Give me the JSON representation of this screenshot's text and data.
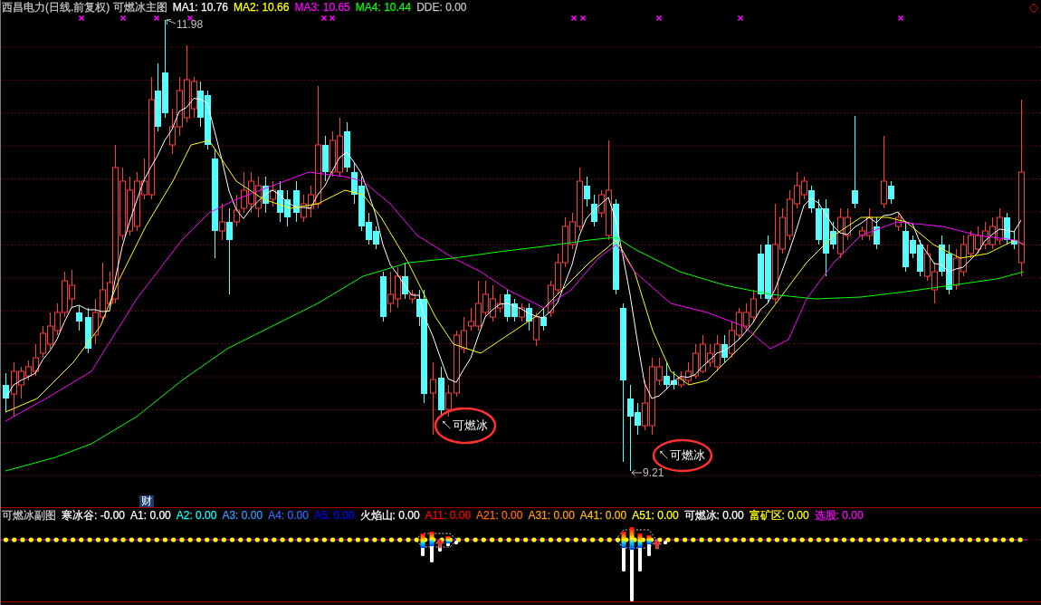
{
  "main_chart": {
    "title": "西昌电力(日线.前复权) 可燃冰主图",
    "indicators": [
      {
        "text": "MA1: 10.76",
        "color": "#ffffff"
      },
      {
        "text": "MA2: 10.66",
        "color": "#ffff00"
      },
      {
        "text": "MA3: 10.65",
        "color": "#ff00ff"
      },
      {
        "text": "MA4: 10.44",
        "color": "#00ff00"
      },
      {
        "text": "DDE: 0.00",
        "color": "#c0c0c0"
      }
    ],
    "high_label": "11.98",
    "low_label": "9.21",
    "signals": [
      "↖可燃冰",
      "↖可燃冰"
    ],
    "tag": "财"
  },
  "sub_chart": {
    "title": "可燃冰副图",
    "indicators": [
      {
        "text": "寒冰谷: -0.00",
        "color": "#ffffff"
      },
      {
        "text": "A1: 0.00",
        "color": "#ffffff"
      },
      {
        "text": "A2: 0.00",
        "color": "#00ffff"
      },
      {
        "text": "A3: 0.00",
        "color": "#3399ff"
      },
      {
        "text": "A4: 0.00",
        "color": "#3366ff"
      },
      {
        "text": "A5: 0.00",
        "color": "#0000ff"
      },
      {
        "text": "火焰山: 0.00",
        "color": "#ffffff"
      },
      {
        "text": "A11: 0.00",
        "color": "#ff0000"
      },
      {
        "text": "A21: 0.00",
        "color": "#ff6600"
      },
      {
        "text": "A31: 0.00",
        "color": "#ff9900"
      },
      {
        "text": "A41: 0.00",
        "color": "#ffbb00"
      },
      {
        "text": "A51: 0.00",
        "color": "#ffff00"
      },
      {
        "text": "可燃冰: 0.00",
        "color": "#ffffff"
      },
      {
        "text": "富矿区: 0.00",
        "color": "#ffff00"
      },
      {
        "text": "选股: 0.00",
        "color": "#ff00ff"
      }
    ]
  }
}
